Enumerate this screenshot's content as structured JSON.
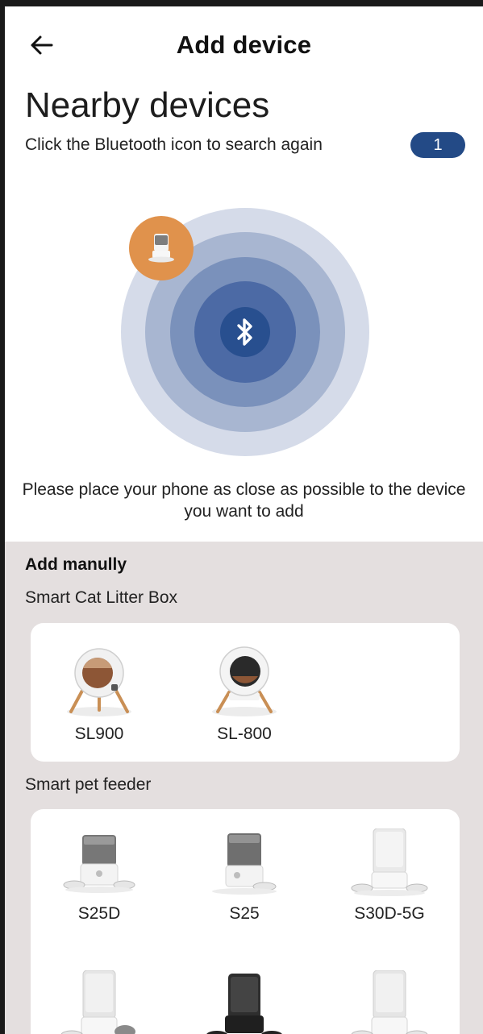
{
  "header": {
    "title": "Add device"
  },
  "nearby": {
    "title": "Nearby devices",
    "hint": "Click the Bluetooth icon to search again",
    "count": "1",
    "place_hint": "Please place your phone as close as possible to the device you want to add"
  },
  "manual": {
    "title": "Add manully",
    "categories": [
      {
        "label": "Smart Cat Litter Box",
        "devices": [
          {
            "name": "SL900"
          },
          {
            "name": "SL-800"
          }
        ]
      },
      {
        "label": "Smart pet feeder",
        "devices": [
          {
            "name": "S25D"
          },
          {
            "name": "S25"
          },
          {
            "name": "S30D-5G"
          }
        ]
      }
    ]
  },
  "colors": {
    "accent": "#234a86",
    "radar_outer": "#d5dbe9",
    "radar_core": "#284f8f",
    "found_device": "#e0924c",
    "manual_bg": "#e4dfdf"
  },
  "icons": {
    "back": "arrow-left-icon",
    "bluetooth": "bluetooth-icon"
  }
}
